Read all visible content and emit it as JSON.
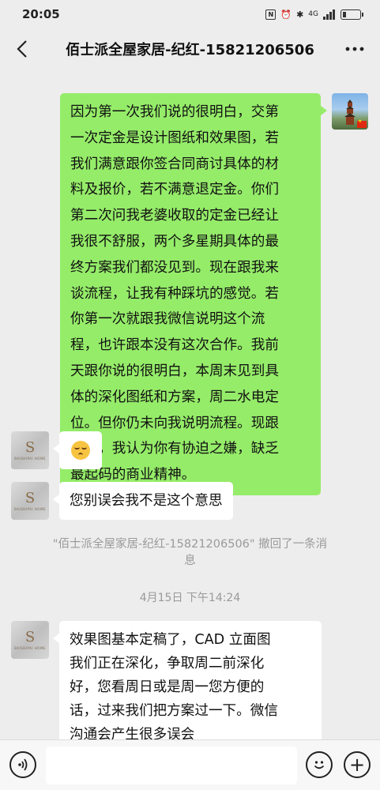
{
  "status_bar": {
    "time": "20:05",
    "nfc": "N",
    "signal_label": "4G",
    "battery_level": 0.2
  },
  "header": {
    "title": "佰士派全屋家居-纪红-15821206506",
    "back_icon": "chevron-left-icon",
    "more_icon": "more-dots-icon"
  },
  "messages": [
    {
      "sender": "me",
      "lines": [
        "因为第一次我们说的很明白，交第",
        "一次定金是设计图纸和效果图，若",
        "我们满意跟你签合同商讨具体的材",
        "料及报价，若不满意退定金。你们",
        "第二次问我老婆收取的定金已经让",
        "我很不舒服，两个多星期具体的最",
        "终方案我们都没见到。现在跟我来",
        "谈流程，让我有种踩坑的感觉。若",
        "你第一次就跟我微信说明这个流",
        "程，也许跟本没有这次合作。我前",
        "天跟你说的很明白，本周末见到具",
        "体的深化图纸和方案，周二水电定",
        "位。但你仍未向我说明流程。现跟",
        "我说，我认为你有协迫之嫌，缺乏",
        "最起码的商业精神。"
      ]
    },
    {
      "sender": "them",
      "emoji": "sleepy-face-emoji"
    },
    {
      "sender": "them",
      "text": "您别误会我不是这个意思"
    },
    {
      "sender": "them",
      "lines": [
        "效果图基本定稿了，CAD 立面图",
        "我们正在深化，争取周二前深化",
        "好，您看周日或是周一您方便的",
        "话，过来我们把方案过一下。微信",
        "沟通会产生很多误会"
      ]
    }
  ],
  "system_notice": {
    "line1": "\"佰士派全屋家居-纪红-15821206506\" 撤回了一条消",
    "line2": "息"
  },
  "timestamp": "4月15日 下午14:24",
  "avatars": {
    "them_logo_letter": "S",
    "them_logo_sub": "BAISHIPAI HOME"
  },
  "input_bar": {
    "voice_icon": "voice-icon",
    "emoji_icon": "emoji-icon",
    "plus_icon": "plus-icon",
    "plus_glyph": "+"
  }
}
